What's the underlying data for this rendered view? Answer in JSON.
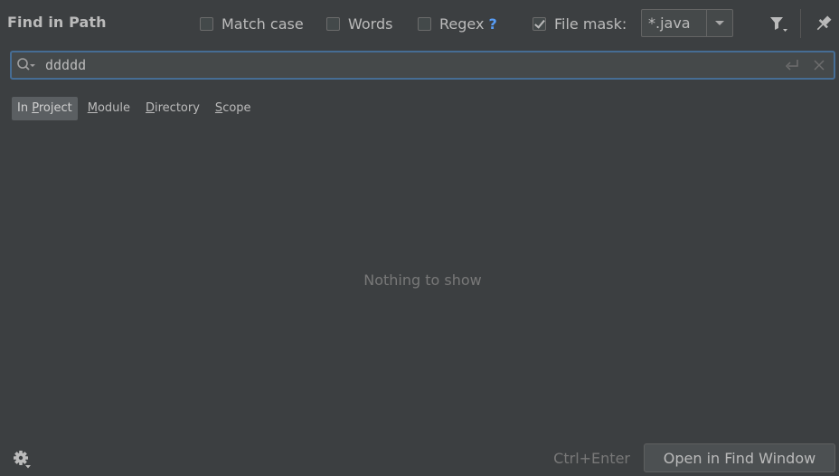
{
  "header": {
    "title": "Find in Path",
    "options": {
      "match_case": {
        "label": "Match case",
        "checked": false
      },
      "words": {
        "label": "Words",
        "checked": false
      },
      "regex": {
        "label": "Regex",
        "help": "?",
        "checked": false
      },
      "file_mask": {
        "label": "File mask:",
        "checked": true,
        "value": "*.java"
      }
    },
    "icons": [
      "filter-icon",
      "pin-icon"
    ]
  },
  "search": {
    "value": "ddddd",
    "icons": [
      "search-history-icon",
      "new-line-icon",
      "clear-icon"
    ]
  },
  "scopes": {
    "tabs": [
      {
        "pre": "In ",
        "mnemonic": "P",
        "post": "roject",
        "active": true
      },
      {
        "pre": "",
        "mnemonic": "M",
        "post": "odule",
        "active": false
      },
      {
        "pre": "",
        "mnemonic": "D",
        "post": "irectory",
        "active": false
      },
      {
        "pre": "",
        "mnemonic": "S",
        "post": "cope",
        "active": false
      }
    ]
  },
  "results": {
    "empty_text": "Nothing to show"
  },
  "footer": {
    "shortcut": "Ctrl+Enter",
    "open_button": "Open in Find Window",
    "icons": [
      "settings-gear-icon"
    ]
  },
  "colors": {
    "background": "#3c3f41",
    "focus_border": "#466d94",
    "help_link": "#589df6",
    "active_tab": "#5b5f62"
  }
}
